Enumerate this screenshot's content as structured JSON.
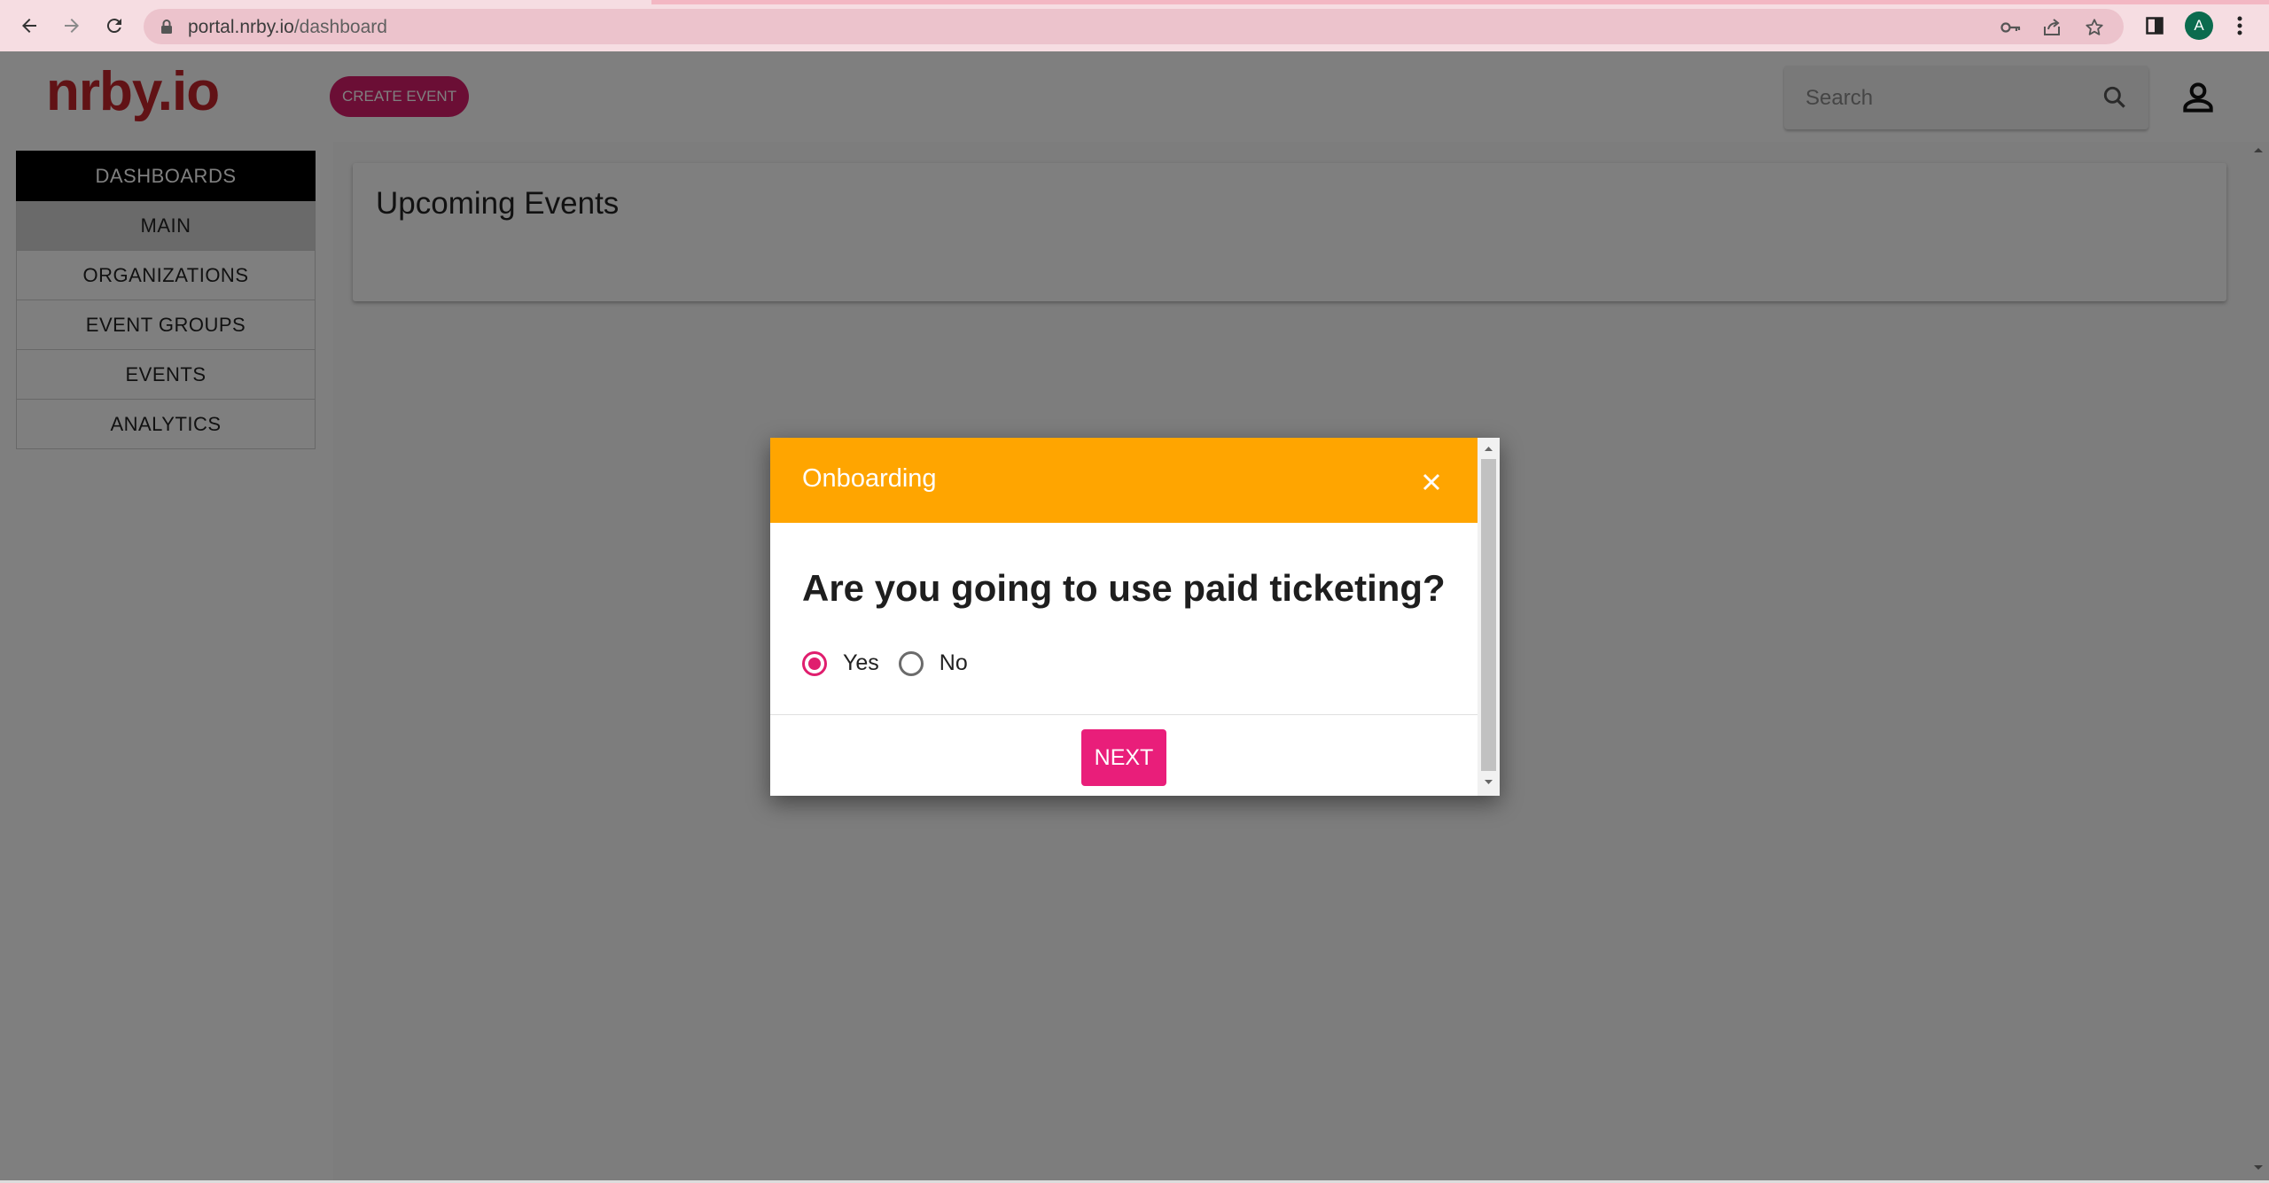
{
  "browser": {
    "url_host": "portal.nrby.io",
    "url_path": "/dashboard",
    "profile_initial": "A"
  },
  "app": {
    "logo_text": "nrby.io",
    "create_event_label": "CREATE EVENT",
    "search": {
      "placeholder": "Search",
      "value": ""
    }
  },
  "sidebar": {
    "items": [
      {
        "label": "DASHBOARDS",
        "kind": "header"
      },
      {
        "label": "MAIN",
        "kind": "active"
      },
      {
        "label": "ORGANIZATIONS",
        "kind": "normal"
      },
      {
        "label": "EVENT GROUPS",
        "kind": "normal"
      },
      {
        "label": "EVENTS",
        "kind": "normal"
      },
      {
        "label": "ANALYTICS",
        "kind": "normal"
      }
    ]
  },
  "main": {
    "card_title": "Upcoming Events"
  },
  "modal": {
    "title": "Onboarding",
    "question": "Are you going to use paid ticketing?",
    "options": [
      {
        "label": "Yes",
        "selected": true
      },
      {
        "label": "No",
        "selected": false
      }
    ],
    "next_label": "NEXT"
  },
  "colors": {
    "modal_header": "#ffa500",
    "accent_pink": "#e91e7a",
    "logo_red": "#c2242a",
    "sidebar_header": "#000000"
  },
  "icons": [
    "back-icon",
    "forward-icon",
    "reload-icon",
    "lock-icon",
    "key-icon",
    "share-icon",
    "star-icon",
    "side-panel-icon",
    "menu-dots-icon",
    "search-icon",
    "account-icon",
    "close-icon"
  ]
}
